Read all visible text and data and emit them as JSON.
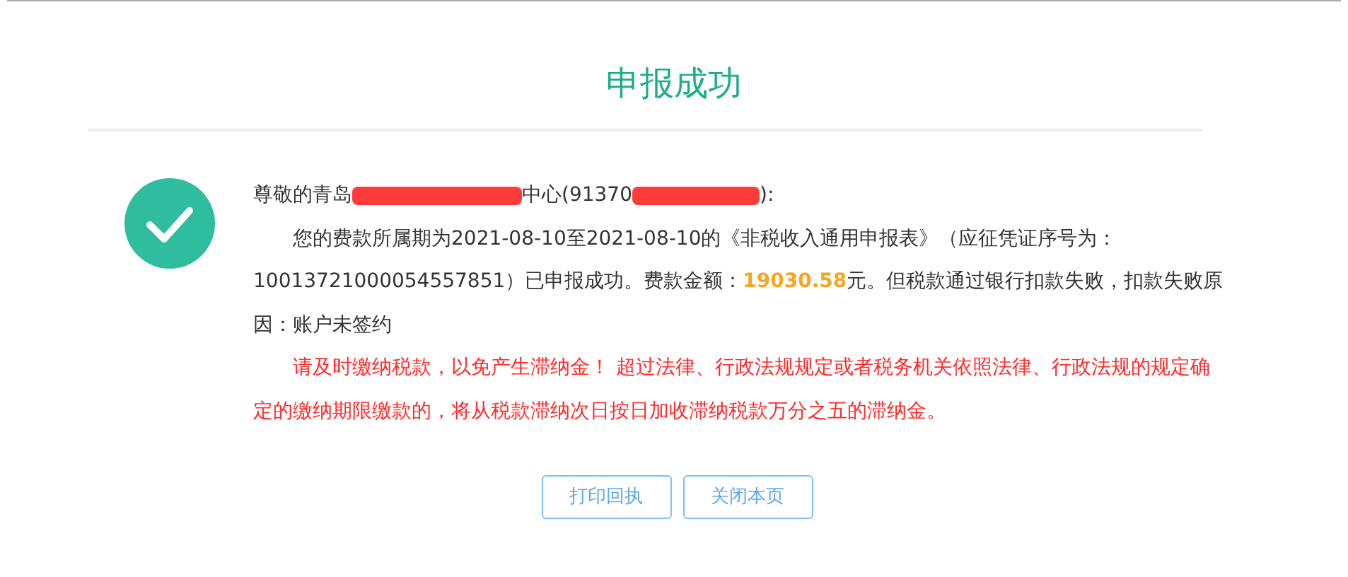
{
  "title": "申报成功",
  "greeting_parts": [
    "尊敬的青岛",
    "中心(91370",
    "):"
  ],
  "message": "您的费款所属期为2021-08-10至2021-08-10的《非税收入通用申报表》（应征凭证序号为：10013721000054557851）已申报成功。费款金额：**19030.58**元。但税款通过银行扣款失败，扣款失败原因：账户未签约",
  "warning": "请及时缴纳税款，以免产生滞纳金！ 超过法律、行政法规规定或者税务机关依照法律、行政法规的规定确定的缴纳期限缴款的，将从税款滞纳次日按日加收滞纳税款万分之五的滞纳金。",
  "buttons": [
    "打印回执",
    "关闭本页"
  ]
}
